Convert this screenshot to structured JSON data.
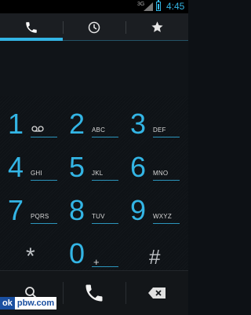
{
  "status_bar": {
    "network": "3G",
    "time": "4:45"
  },
  "tabs": [
    {
      "name": "phone",
      "icon": "phone-icon",
      "selected": true
    },
    {
      "name": "call-log",
      "icon": "clock-icon",
      "selected": false
    },
    {
      "name": "favorites",
      "icon": "star-icon",
      "selected": false
    }
  ],
  "dialpad": {
    "keys": [
      {
        "digit": "1",
        "letters": ""
      },
      {
        "digit": "2",
        "letters": "ABC"
      },
      {
        "digit": "3",
        "letters": "DEF"
      },
      {
        "digit": "4",
        "letters": "GHI"
      },
      {
        "digit": "5",
        "letters": "JKL"
      },
      {
        "digit": "6",
        "letters": "MNO"
      },
      {
        "digit": "7",
        "letters": "PQRS"
      },
      {
        "digit": "8",
        "letters": "TUV"
      },
      {
        "digit": "9",
        "letters": "WXYZ"
      },
      {
        "digit": "*",
        "letters": ""
      },
      {
        "digit": "0",
        "letters": "+"
      },
      {
        "digit": "#",
        "letters": ""
      }
    ]
  },
  "bottom_bar": {
    "buttons": [
      "search-icon",
      "phone-icon",
      "backspace-icon"
    ]
  },
  "watermark": {
    "part_a": "ok",
    "part_b": "pbw.com"
  },
  "colors": {
    "accent": "#33b5e5",
    "background": "#0e1216",
    "text": "#d8d8d8"
  }
}
